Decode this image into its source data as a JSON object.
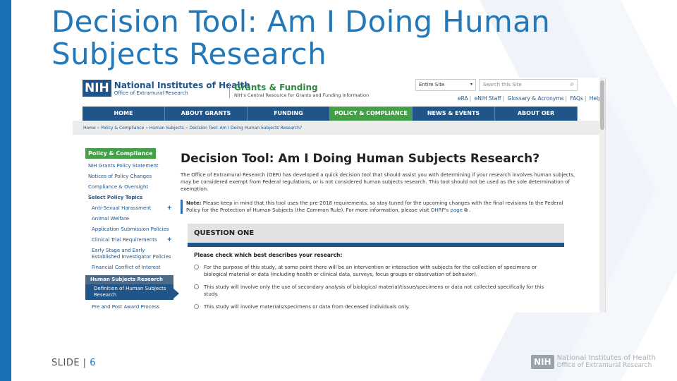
{
  "slide": {
    "title_line1": "Decision Tool: Am I Doing Human",
    "title_line2": "Subjects Research",
    "footer_label": "SLIDE | ",
    "footer_number": "6",
    "footer_logo": {
      "badge": "NIH",
      "line1": "National Institutes of Health",
      "line2": "Office of Extramural Research"
    },
    "colors": {
      "accent": "#1b6fb5",
      "title": "#2478b8",
      "chevron": "#eaf2f9"
    }
  },
  "screenshot": {
    "header": {
      "logo_badge": "NIH",
      "logo_title": "National Institutes of Health",
      "logo_subtitle": "Office of Extramural Research",
      "section_title": "Grants & Funding",
      "section_subtitle": "NIH's Central Resource for Grants and Funding Information",
      "site_select": "Entire Site",
      "search_placeholder": "Search this Site",
      "links": [
        "eRA",
        "eNIH Staff",
        "Glossary & Acronyms",
        "FAQs",
        "Help"
      ]
    },
    "nav": [
      "HOME",
      "ABOUT GRANTS",
      "FUNDING",
      "POLICY & COMPLIANCE",
      "NEWS & EVENTS",
      "ABOUT OER"
    ],
    "nav_active": "POLICY & COMPLIANCE",
    "breadcrumb": [
      "Home",
      "Policy & Compliance",
      "Human Subjects",
      "Decision Tool: Am I Doing Human Subjects Research?"
    ],
    "sidebar": {
      "heading": "Policy & Compliance",
      "items": [
        "NIH Grants Policy Statement",
        "Notices of Policy Changes",
        "Compliance & Oversight"
      ],
      "topics_heading": "Select Policy Topics",
      "topics": [
        "Anti-Sexual Harassment",
        "Animal Welfare",
        "Application Submission Policies",
        "Clinical Trial Requirements",
        "Early Stage and Early Established Investigator Policies",
        "Financial Conflict of Interest"
      ],
      "current_section": "Human Subjects Research",
      "current_page": "Definition of Human Subjects Research",
      "cut_item": "Pre and Post Award Process"
    },
    "main": {
      "heading": "Decision Tool: Am I Doing Human Subjects Research?",
      "intro": "The Office of Extramural Research (OER) has developed a quick decision tool that should assist you with determining if your research involves human subjects, may be considered exempt from Federal regulations, or is not considered human subjects research. This tool should not be used as the sole determination of exemption.",
      "note_label": "Note:",
      "note_text": " Please keep in mind that this tool uses the pre-2018 requirements, so stay tuned for the upcoming changes with the final revisions to the Federal Policy for the Protection of Human Subjects (the Common Rule). For more information, please visit ",
      "note_link": "OHRP's page",
      "note_end": " .",
      "question_title": "QUESTION ONE",
      "question_prompt": "Please check which best describes your research:",
      "options": [
        "For the purpose of this study, at some point there will be an intervention or interaction with subjects for the collection of specimens or biological material or data (including health or clinical data, surveys, focus groups or observation of behavior).",
        "This study will involve only the use of secondary analysis of biological material/tissue/specimens or data not collected specifically for this study.",
        "This study will involve materials/specimens or data from deceased individuals only."
      ]
    }
  }
}
